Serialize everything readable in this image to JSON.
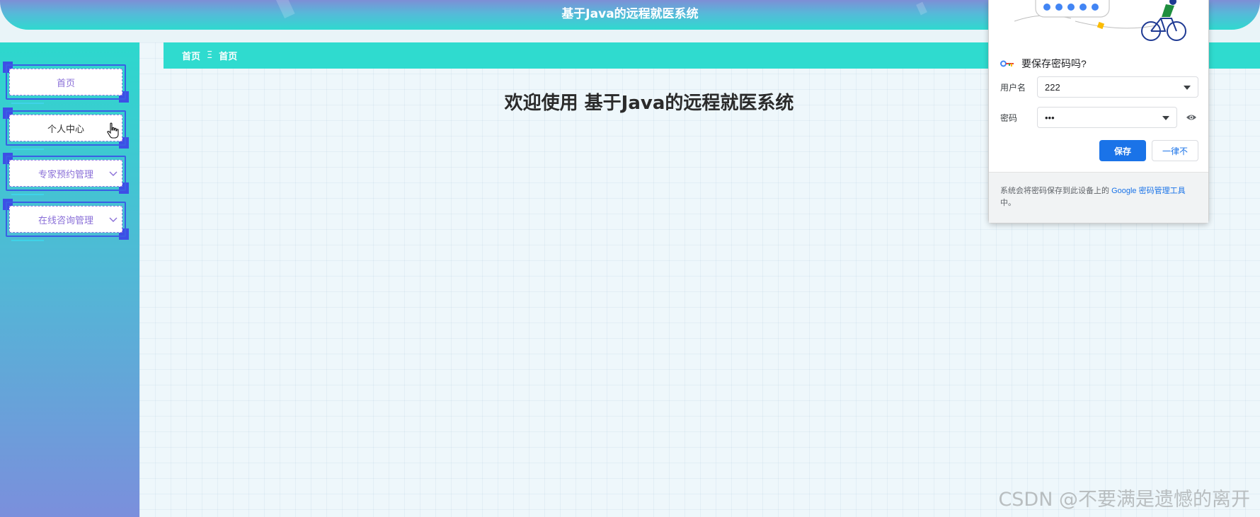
{
  "header": {
    "title": "基于Java的远程就医系统"
  },
  "sidebar": {
    "items": [
      {
        "label": "首页",
        "has_submenu": false
      },
      {
        "label": "个人中心",
        "has_submenu": false
      },
      {
        "label": "专家预约管理",
        "has_submenu": true
      },
      {
        "label": "在线咨询管理",
        "has_submenu": true
      }
    ]
  },
  "breadcrumb": {
    "root": "首页",
    "separator": "Ξ",
    "current": "首页"
  },
  "main": {
    "welcome": "欢迎使用 基于Java的远程就医系统"
  },
  "password_popup": {
    "title": "要保存密码吗?",
    "username_label": "用户名",
    "username_value": "222",
    "password_label": "密码",
    "password_value": "•••",
    "save_button": "保存",
    "never_button": "一律不",
    "footer_prefix": "系统会将密码保存到此设备上的 ",
    "footer_link": "Google 密码管理工具",
    "footer_suffix": "中。"
  },
  "watermark": "CSDN @不要满是遗憾的离开",
  "colors": {
    "accent": "#2fdbcf",
    "sidebar_top": "#2dd8cd",
    "sidebar_bottom": "#7b8fdc",
    "menu_text": "#8a6fd8",
    "popup_primary": "#1a73e8"
  }
}
